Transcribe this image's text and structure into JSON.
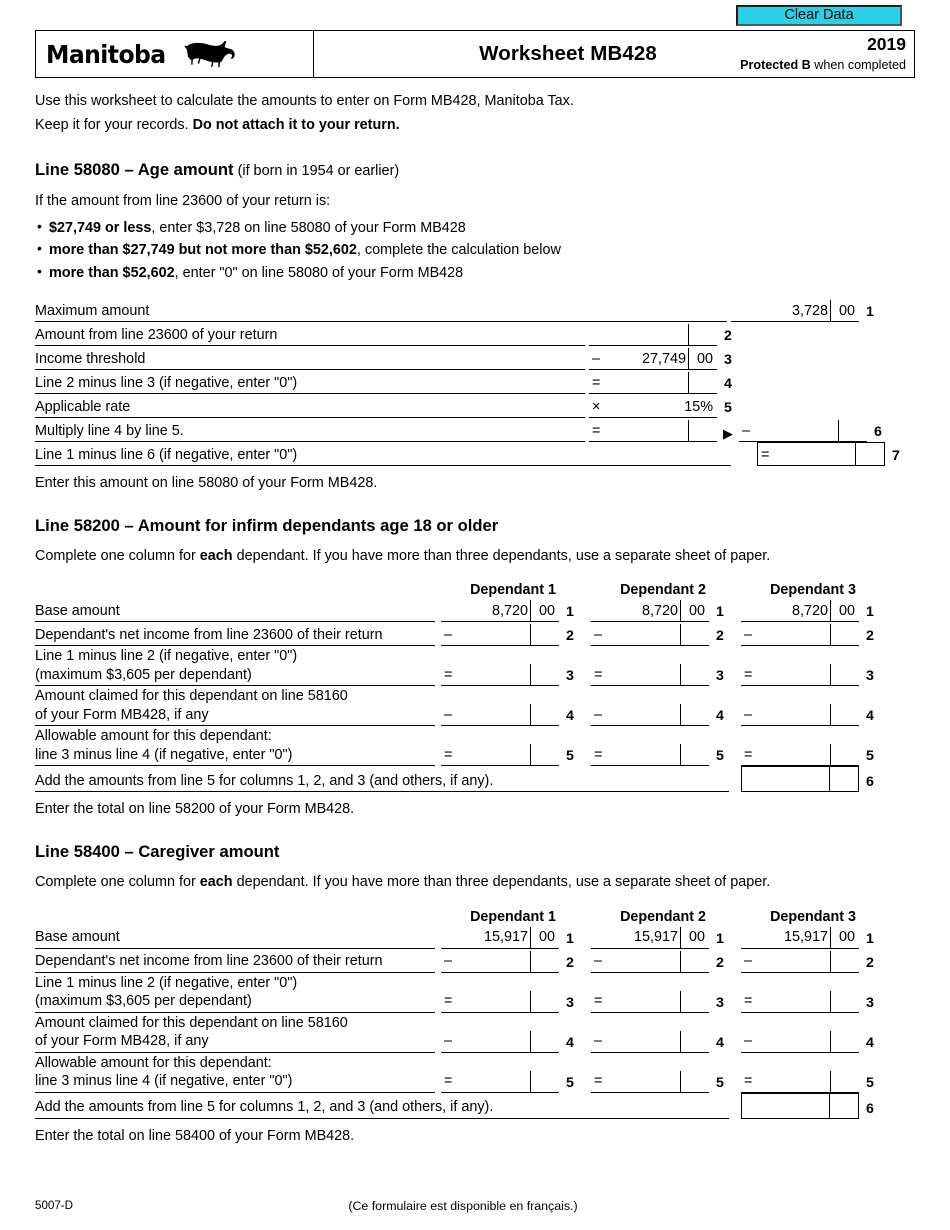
{
  "toolbar": {
    "clear_data_label": "Clear Data"
  },
  "header": {
    "province": "Manitoba",
    "title": "Worksheet MB428",
    "year": "2019",
    "protected_bold": "Protected B",
    "protected_rest": " when completed"
  },
  "intro": {
    "line1": "Use this worksheet to calculate the amounts to enter on Form MB428, Manitoba Tax.",
    "line2_plain": "Keep it for your records. ",
    "line2_bold": "Do not attach it to your return."
  },
  "section_58080": {
    "heading_bold": "Line 58080 – Age amount",
    "heading_light": " (if born in 1954 or earlier)",
    "lead": "If the amount from line 23600 of your return is:",
    "bullets": [
      {
        "bold": "$27,749 or less",
        "rest": ", enter $3,728 on line 58080 of your Form MB428"
      },
      {
        "bold": "more than $27,749 but not more than $52,602",
        "rest": ", complete the calculation below"
      },
      {
        "bold": "more than $52,602",
        "rest": ", enter \"0\" on line 58080 of your Form MB428"
      }
    ],
    "rows": [
      {
        "label": "Maximum amount",
        "op": "",
        "value": "3,728",
        "cents": "00",
        "num": "1"
      },
      {
        "label": "Amount from line 23600 of your return",
        "op": "",
        "value": "",
        "cents": "",
        "num": "2"
      },
      {
        "label": "Income threshold",
        "op": "–",
        "value": "27,749",
        "cents": "00",
        "num": "3"
      },
      {
        "label": "Line 2 minus line 3 (if negative, enter \"0\")",
        "op": "=",
        "value": "",
        "cents": "",
        "num": "4"
      },
      {
        "label": "Applicable rate",
        "op": "×",
        "value": "",
        "cents": "",
        "pct": "15%",
        "num": "5"
      },
      {
        "label": "Multiply line 4 by line 5.",
        "op": "=",
        "value": "",
        "cents": "",
        "num": "6"
      },
      {
        "label": "Line 1 minus line 6 (if negative, enter \"0\")",
        "op": "",
        "value": "",
        "cents": "",
        "num": "7"
      }
    ],
    "line6_op": "–",
    "line6_num": "6",
    "line7_op": "=",
    "line7_num": "7",
    "footer_note": "Enter this amount on line 58080 of your Form MB428."
  },
  "section_58200": {
    "heading": "Line 58200 – Amount for infirm dependants age 18 or older",
    "note_pre": "Complete one column for ",
    "note_bold": "each",
    "note_post": " dependant. If you have more than three dependants, use a separate sheet of paper.",
    "columns": [
      "Dependant 1",
      "Dependant 2",
      "Dependant 3"
    ],
    "base_amount": "8,720",
    "base_cents": "00",
    "rows": [
      {
        "label": "Base amount",
        "label2": "",
        "op": "",
        "num": "1"
      },
      {
        "label": "Dependant's net income from line 23600 of their return",
        "label2": "",
        "op": "–",
        "num": "2"
      },
      {
        "label": "Line 1 minus line 2 (if negative, enter \"0\")",
        "label2": "(maximum $3,605 per dependant)",
        "op": "=",
        "num": "3"
      },
      {
        "label": "Amount claimed for this dependant on line 58160",
        "label2": "of your Form MB428, if any",
        "op": "–",
        "num": "4"
      },
      {
        "label": "Allowable amount for this dependant:",
        "label2": "line 3 minus line 4 (if negative, enter \"0\")",
        "op": "=",
        "num": "5"
      }
    ],
    "total_label": "Add the amounts from line 5 for columns 1, 2, and 3 (and others, if any).",
    "total_num": "6",
    "footer_note": "Enter the total on line 58200 of your Form MB428."
  },
  "section_58400": {
    "heading": "Line 58400 – Caregiver amount",
    "note_pre": "Complete one column for ",
    "note_bold": "each",
    "note_post": " dependant. If you have more than three dependants, use a separate sheet of paper.",
    "columns": [
      "Dependant 1",
      "Dependant 2",
      "Dependant 3"
    ],
    "base_amount": "15,917",
    "base_cents": "00",
    "rows": [
      {
        "label": "Base amount",
        "label2": "",
        "op": "",
        "num": "1"
      },
      {
        "label": "Dependant's net income from line 23600 of their return",
        "label2": "",
        "op": "–",
        "num": "2"
      },
      {
        "label": "Line 1 minus line 2 (if negative, enter \"0\")",
        "label2": "(maximum $3,605 per dependant)",
        "op": "=",
        "num": "3"
      },
      {
        "label": "Amount claimed for this dependant on line 58160",
        "label2": "of your Form MB428, if any",
        "op": "–",
        "num": "4"
      },
      {
        "label": "Allowable amount for this dependant:",
        "label2": "line 3 minus line 4 (if negative, enter \"0\")",
        "op": "=",
        "num": "5"
      }
    ],
    "total_label": "Add the amounts from line 5 for columns 1, 2, and 3 (and others, if any).",
    "total_num": "6",
    "footer_note": "Enter the total on line 58400 of your Form MB428."
  },
  "footer": {
    "form_code": "5007-D",
    "french_note": "(Ce formulaire est disponible en français.)"
  }
}
